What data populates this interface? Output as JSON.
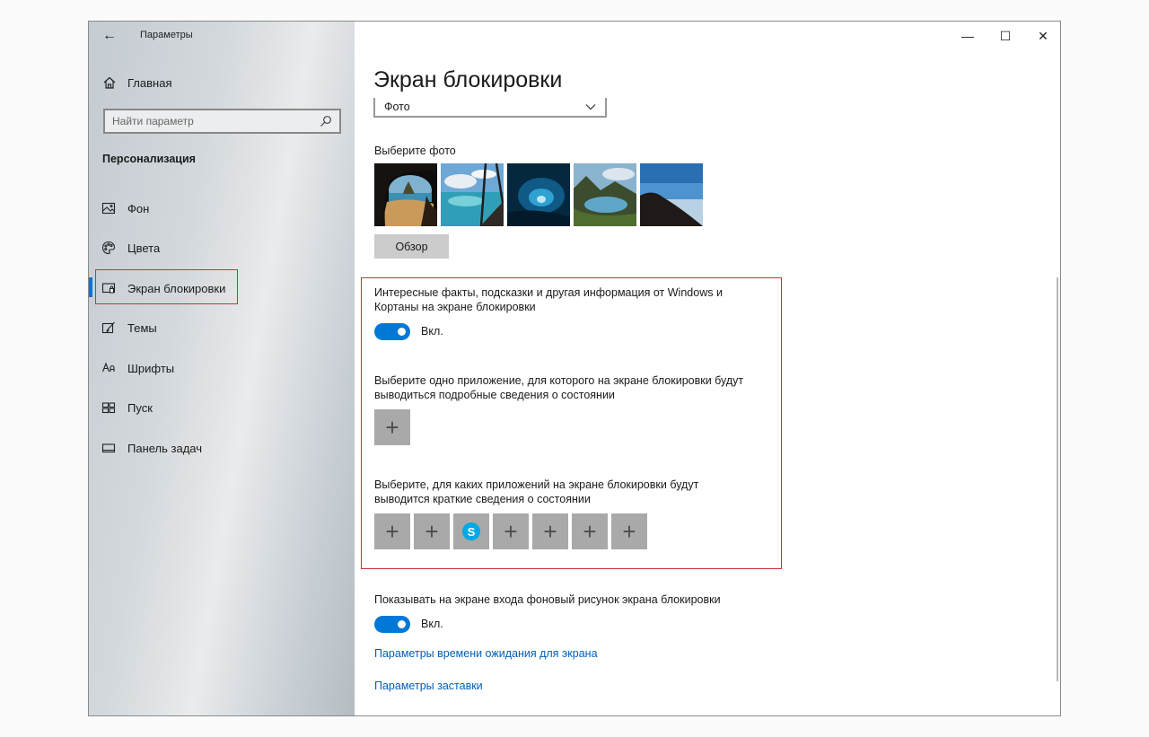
{
  "window": {
    "app_title": "Параметры",
    "back_icon": "arrow-left-icon",
    "controls": {
      "minimize": "—",
      "maximize": "☐",
      "close": "✕"
    }
  },
  "sidebar": {
    "home_label": "Главная",
    "search_placeholder": "Найти параметр",
    "section_title": "Персонализация",
    "items": [
      {
        "label": "Фон",
        "icon": "image-icon"
      },
      {
        "label": "Цвета",
        "icon": "palette-icon"
      },
      {
        "label": "Экран блокировки",
        "icon": "lock-screen-icon",
        "active": true
      },
      {
        "label": "Темы",
        "icon": "themes-icon"
      },
      {
        "label": "Шрифты",
        "icon": "fonts-icon"
      },
      {
        "label": "Пуск",
        "icon": "start-icon"
      },
      {
        "label": "Панель задач",
        "icon": "taskbar-icon"
      }
    ]
  },
  "main": {
    "page_title": "Экран блокировки",
    "background_dropdown_value": "Фото",
    "choose_photo_label": "Выберите фото",
    "browse_button": "Обзор",
    "fun_facts_label": "Интересные факты, подсказки и другая информация от Windows и Кортаны на экране блокировки",
    "fun_facts_toggle": "Вкл.",
    "detailed_status_label": "Выберите одно приложение, для которого на экране блокировки будут выводиться подробные сведения о состоянии",
    "quick_status_label": "Выберите, для каких приложений на экране блокировки будут выводится краткие сведения о состоянии",
    "quick_status_tiles": [
      "+",
      "+",
      "skype",
      "+",
      "+",
      "+",
      "+"
    ],
    "show_background_label": "Показывать на экране входа фоновый рисунок экрана блокировки",
    "show_background_toggle": "Вкл.",
    "screen_timeout_link": "Параметры времени ожидания для экрана",
    "screensaver_link": "Параметры заставки"
  },
  "colors": {
    "accent": "#0078d7",
    "highlight_border": "#d0303a",
    "link": "#005fb8"
  }
}
